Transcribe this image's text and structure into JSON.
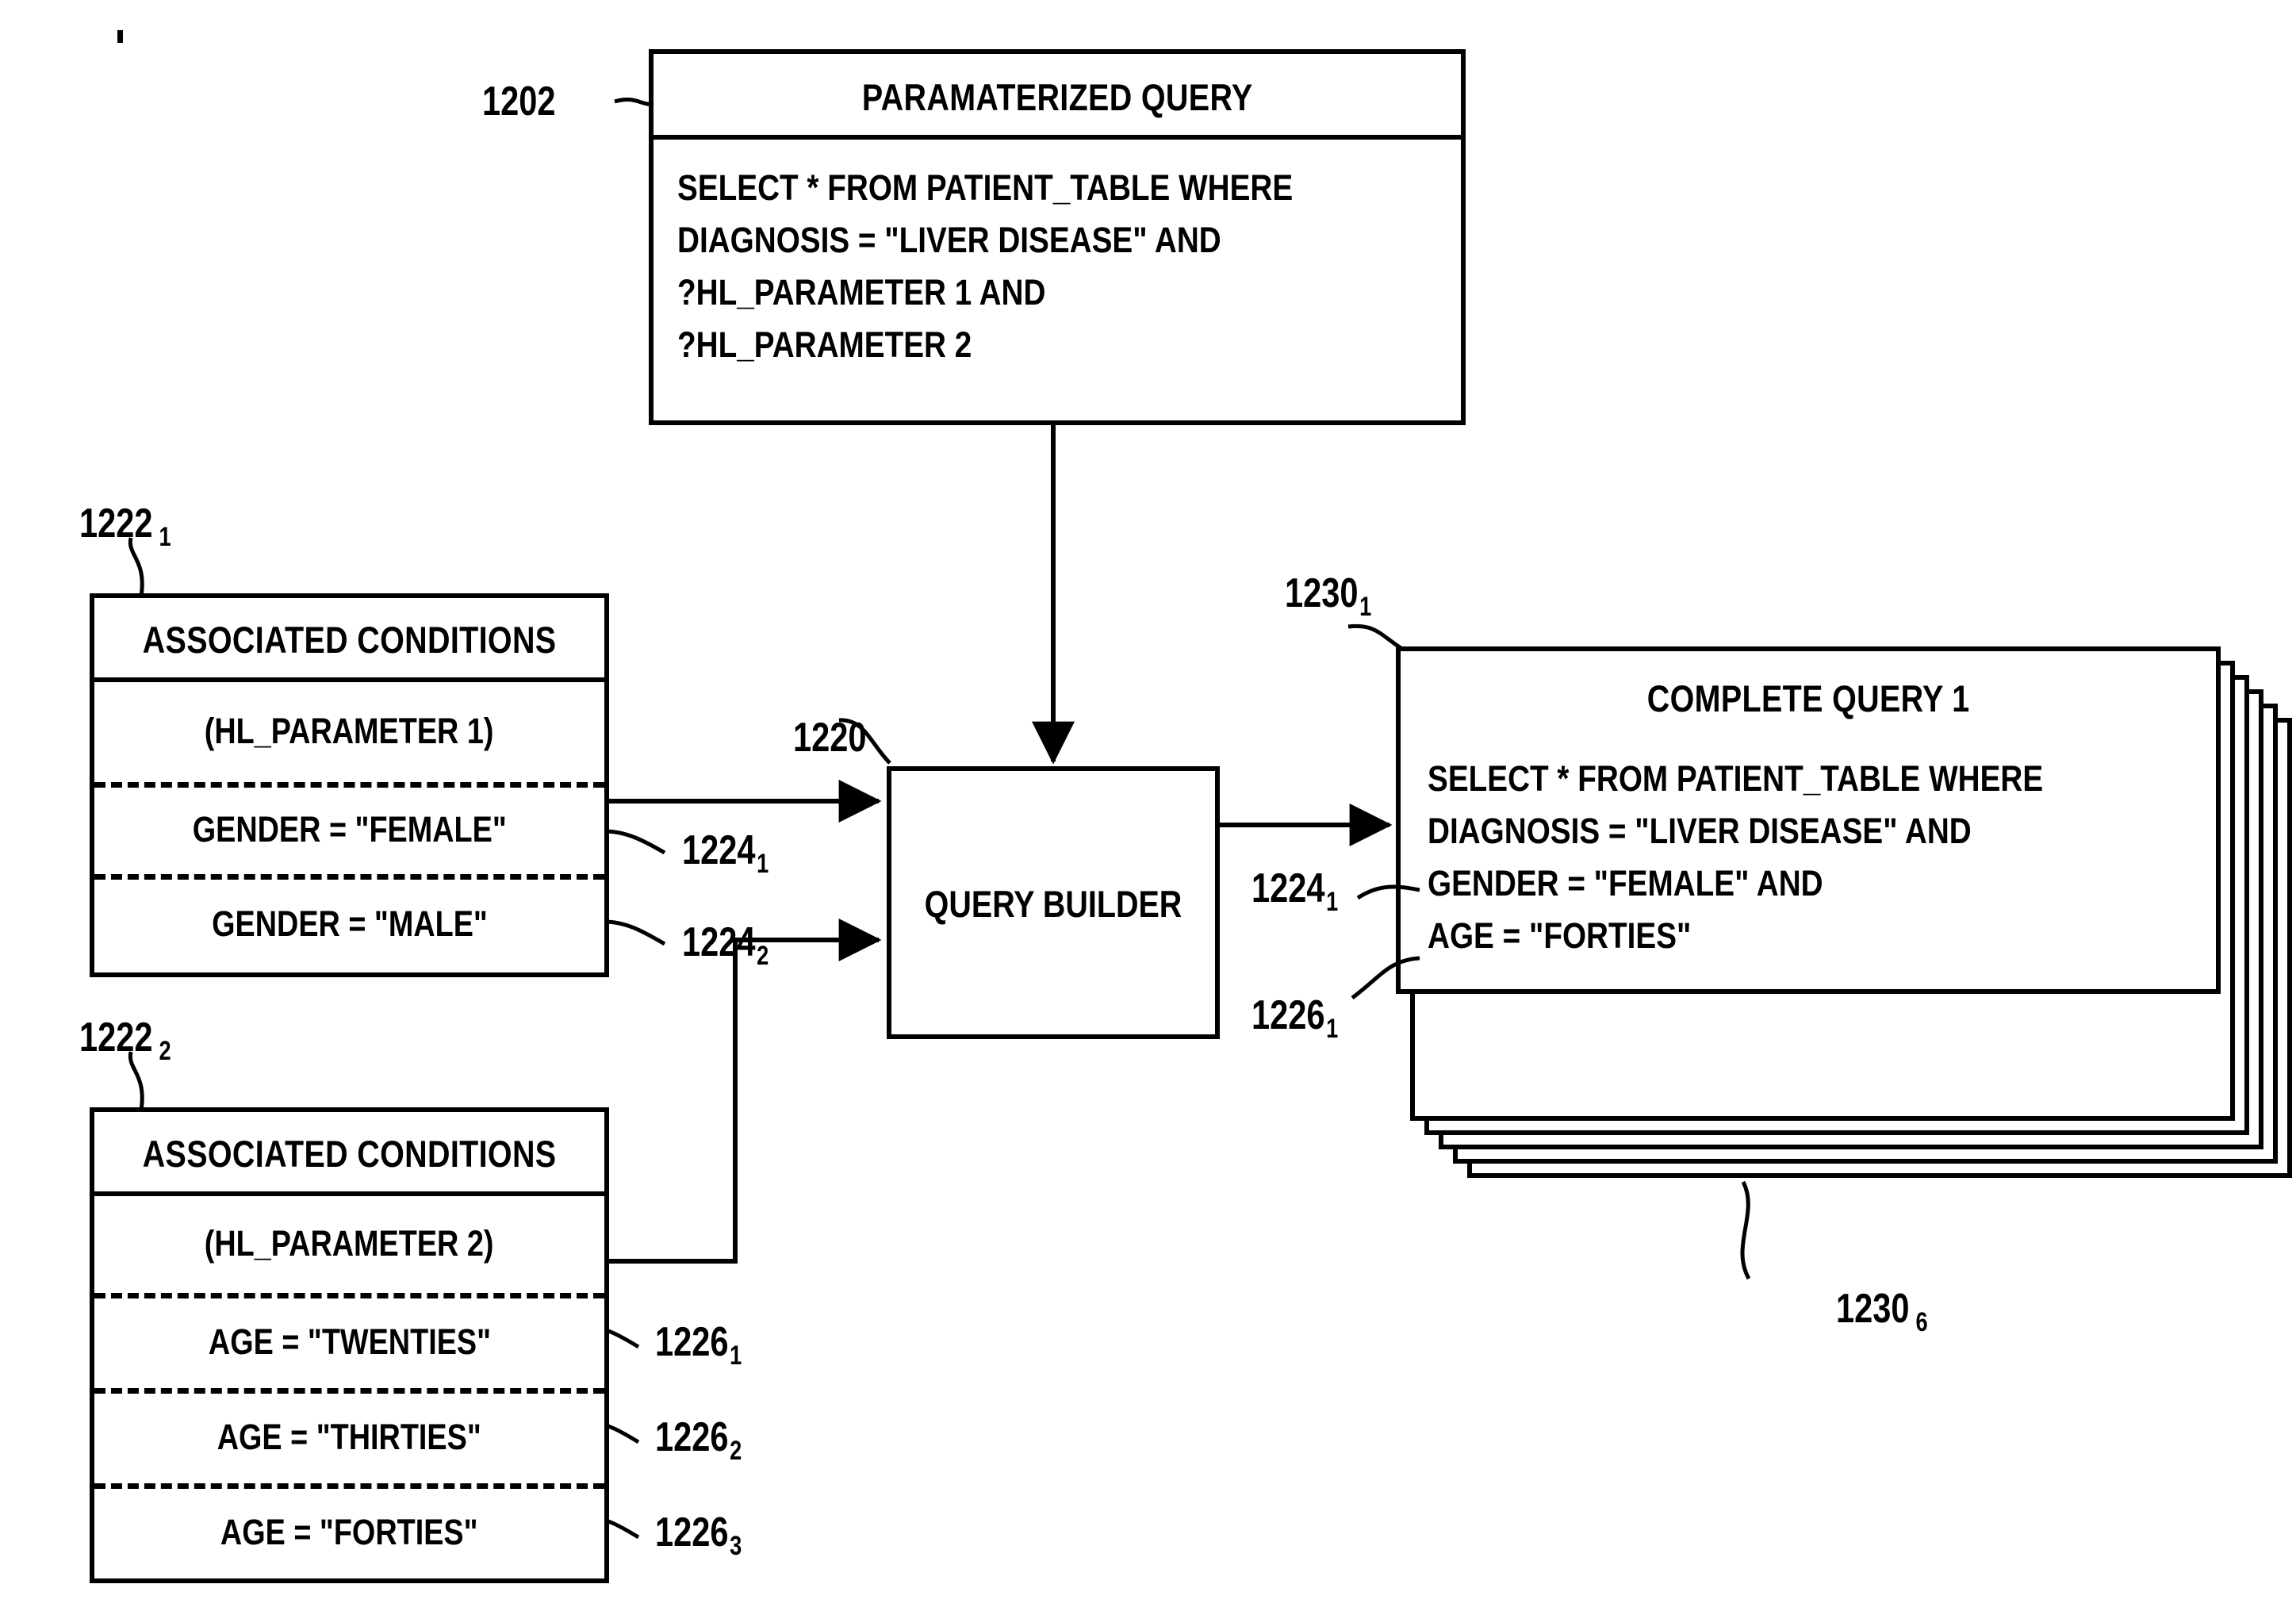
{
  "figure": {
    "type": "patent-block-diagram",
    "background": "#ffffff",
    "stroke": "#000000"
  },
  "parameterized_query": {
    "ref": "1202",
    "title": "PARAMATERIZED QUERY",
    "body_lines": [
      "SELECT * FROM PATIENT_TABLE WHERE",
      "DIAGNOSIS = \"LIVER DISEASE\" AND",
      "?HL_PARAMETER 1 AND",
      "?HL_PARAMETER 2"
    ]
  },
  "associated_conditions_1": {
    "ref": "1222",
    "ref_sub": "1",
    "title": "ASSOCIATED CONDITIONS",
    "parameter": "(HL_PARAMETER 1)",
    "conditions": [
      {
        "text": "GENDER = \"FEMALE\"",
        "ref": "1224",
        "ref_sub": "1"
      },
      {
        "text": "GENDER = \"MALE\"",
        "ref": "1224",
        "ref_sub": "2"
      }
    ]
  },
  "associated_conditions_2": {
    "ref": "1222",
    "ref_sub": "2",
    "title": "ASSOCIATED CONDITIONS",
    "parameter": "(HL_PARAMETER 2)",
    "conditions": [
      {
        "text": "AGE = \"TWENTIES\"",
        "ref": "1226",
        "ref_sub": "1"
      },
      {
        "text": "AGE = \"THIRTIES\"",
        "ref": "1226",
        "ref_sub": "2"
      },
      {
        "text": "AGE = \"FORTIES\"",
        "ref": "1226",
        "ref_sub": "3"
      }
    ]
  },
  "query_builder": {
    "ref": "1220",
    "label": "QUERY BUILDER"
  },
  "complete_query": {
    "ref_front": "1230",
    "ref_front_sub": "1",
    "ref_back": "1230",
    "ref_back_sub": "6",
    "title": "COMPLETE QUERY 1",
    "body_lines": [
      "SELECT * FROM PATIENT_TABLE WHERE",
      "DIAGNOSIS = \"LIVER DISEASE\" AND",
      "GENDER = \"FEMALE\" AND",
      "AGE = \"FORTIES\""
    ],
    "stack_count": 6,
    "callouts": [
      {
        "ref": "1224",
        "ref_sub": "1"
      },
      {
        "ref": "1226",
        "ref_sub": "1"
      }
    ]
  }
}
